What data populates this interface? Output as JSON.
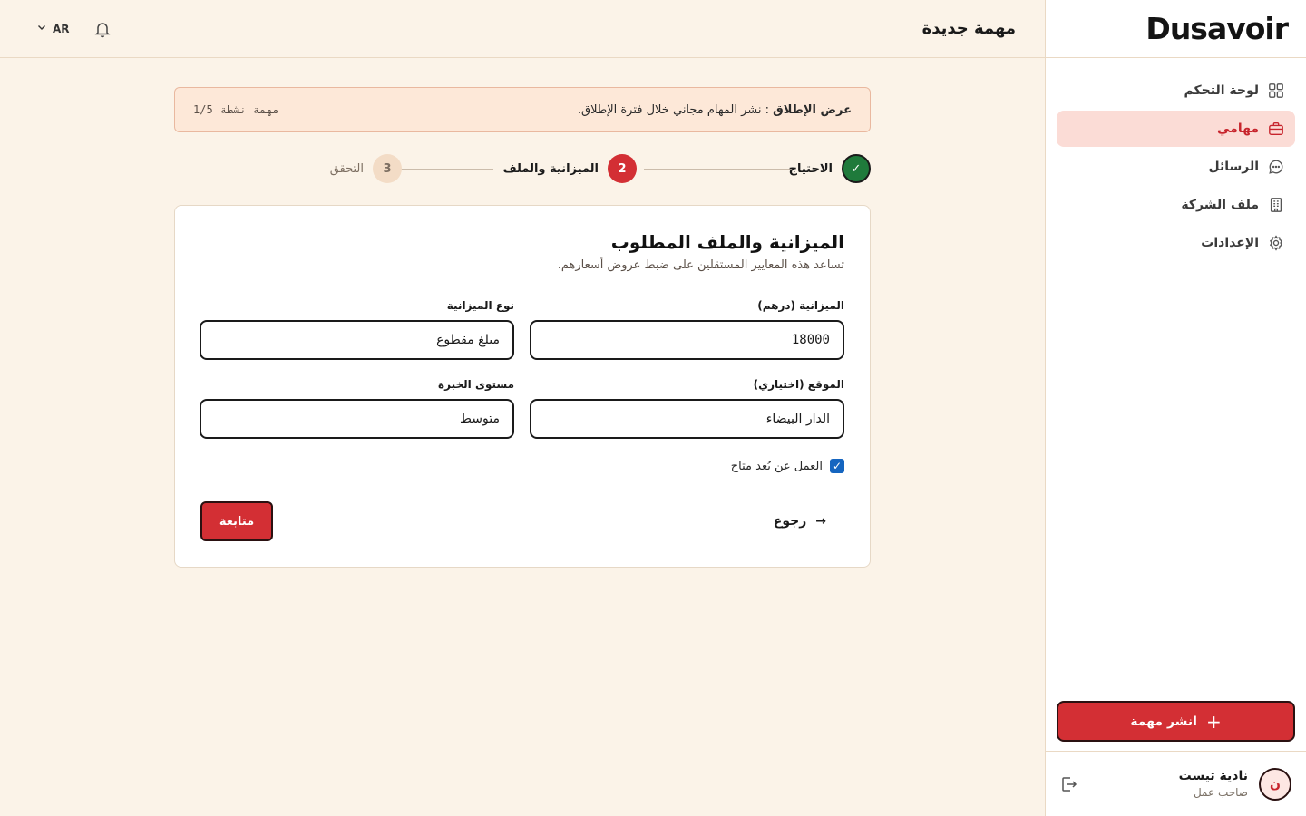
{
  "brand": {
    "logo_text": "Dusavoir"
  },
  "sidebar": {
    "items": [
      {
        "label": "لوحة التحكم",
        "icon": "grid-icon",
        "active": false
      },
      {
        "label": "مهامي",
        "icon": "briefcase-icon",
        "active": true
      },
      {
        "label": "الرسائل",
        "icon": "chat-icon",
        "active": false
      },
      {
        "label": "ملف الشركة",
        "icon": "building-icon",
        "active": false
      },
      {
        "label": "الإعدادات",
        "icon": "gear-icon",
        "active": false
      }
    ],
    "publish_label": "انشر مهمة",
    "user": {
      "initial": "ن",
      "name": "نادية تيست",
      "role": "صاحب عمل"
    }
  },
  "header": {
    "title": "مهمة جديدة",
    "language": "AR"
  },
  "banner": {
    "title": "عرض الإطلاق",
    "text": " : نشر المهام مجاني خلال فترة الإطلاق.",
    "count": "1/5",
    "count_label": "مهمة نشطة"
  },
  "stepper": {
    "steps": [
      {
        "number": "✓",
        "label": "الاحتياج",
        "state": "done"
      },
      {
        "number": "2",
        "label": "الميزانية والملف",
        "state": "current"
      },
      {
        "number": "3",
        "label": "التحقق",
        "state": "todo"
      }
    ]
  },
  "form": {
    "title": "الميزانية والملف المطلوب",
    "subtitle": "تساعد هذه المعايير المستقلين على ضبط عروض أسعارهم.",
    "budget_label": "الميزانية (درهم)",
    "budget_value": "18000",
    "budget_type_label": "نوع الميزانية",
    "budget_type_value": "مبلغ مقطوع",
    "location_label": "الموقع (اختياري)",
    "location_value": "الدار البيضاء",
    "experience_label": "مستوى الخبرة",
    "experience_value": "متوسط",
    "remote_label": "العمل عن بُعد متاح",
    "remote_checked": true,
    "back_label": "رجوع",
    "next_label": "متابعة"
  },
  "colors": {
    "accent": "#d32f34",
    "success": "#1f7a3b",
    "background": "#fbf3e8",
    "checkbox": "#1565c0"
  }
}
